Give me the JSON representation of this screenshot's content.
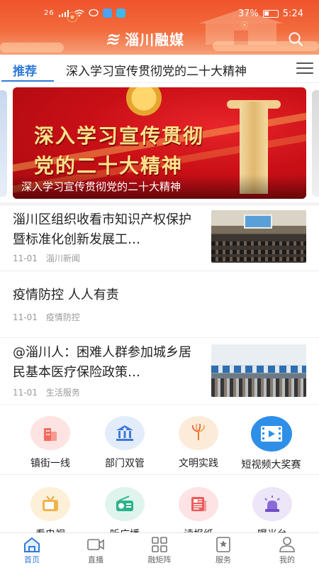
{
  "status_bar": {
    "battery": "37%",
    "time": "5:24",
    "signal": "26"
  },
  "header": {
    "logo_text": "淄川融媒",
    "accent": "#f0542c"
  },
  "tabs": [
    {
      "label": "推荐",
      "active": true
    },
    {
      "label": "深入学习宣传贯彻党的二十大精神",
      "active": false
    }
  ],
  "banner": {
    "slogan_line1": "深入学习宣传贯彻",
    "slogan_line2": "党的二十大精神",
    "caption": "深入学习宣传贯彻党的二十大精神"
  },
  "news": [
    {
      "title": "淄川区组织收看市知识产权保护暨标准化创新发展工…",
      "date": "11-01",
      "source": "淄川新闻",
      "thumb": "meeting-photo"
    },
    {
      "title": "疫情防控 人人有责",
      "date": "11-01",
      "source": "疫情防控"
    },
    {
      "title": "@淄川人：困难人群参加城乡居民基本医疗保险政策…",
      "date": "11-01",
      "source": "生活服务",
      "thumb": "service-hall-photo"
    }
  ],
  "services": [
    {
      "label": "镇街一线",
      "icon": "building-icon",
      "bg": "#fde3e1"
    },
    {
      "label": "部门双管",
      "icon": "government-icon",
      "bg": "#e3ecfb"
    },
    {
      "label": "文明实践",
      "icon": "torch-icon",
      "bg": "#fdebd9"
    },
    {
      "label": "短视频大奖赛",
      "icon": "film-icon",
      "bg": "#2f8fe8"
    },
    {
      "label": "看电视",
      "icon": "tv-icon",
      "bg": "#fdf0d8"
    },
    {
      "label": "听广播",
      "icon": "radio-icon",
      "bg": "#dff4ec"
    },
    {
      "label": "读报纸",
      "icon": "newspaper-icon",
      "bg": "#fde3e3"
    },
    {
      "label": "曝光台",
      "icon": "siren-icon",
      "bg": "#ece6f8"
    }
  ],
  "bottom_nav": [
    {
      "label": "首页",
      "icon": "home-icon",
      "active": true
    },
    {
      "label": "直播",
      "icon": "video-icon",
      "active": false
    },
    {
      "label": "融矩阵",
      "icon": "grid-icon",
      "active": false
    },
    {
      "label": "服务",
      "icon": "bookmark-star-icon",
      "active": false
    },
    {
      "label": "我的",
      "icon": "person-icon",
      "active": false
    }
  ]
}
